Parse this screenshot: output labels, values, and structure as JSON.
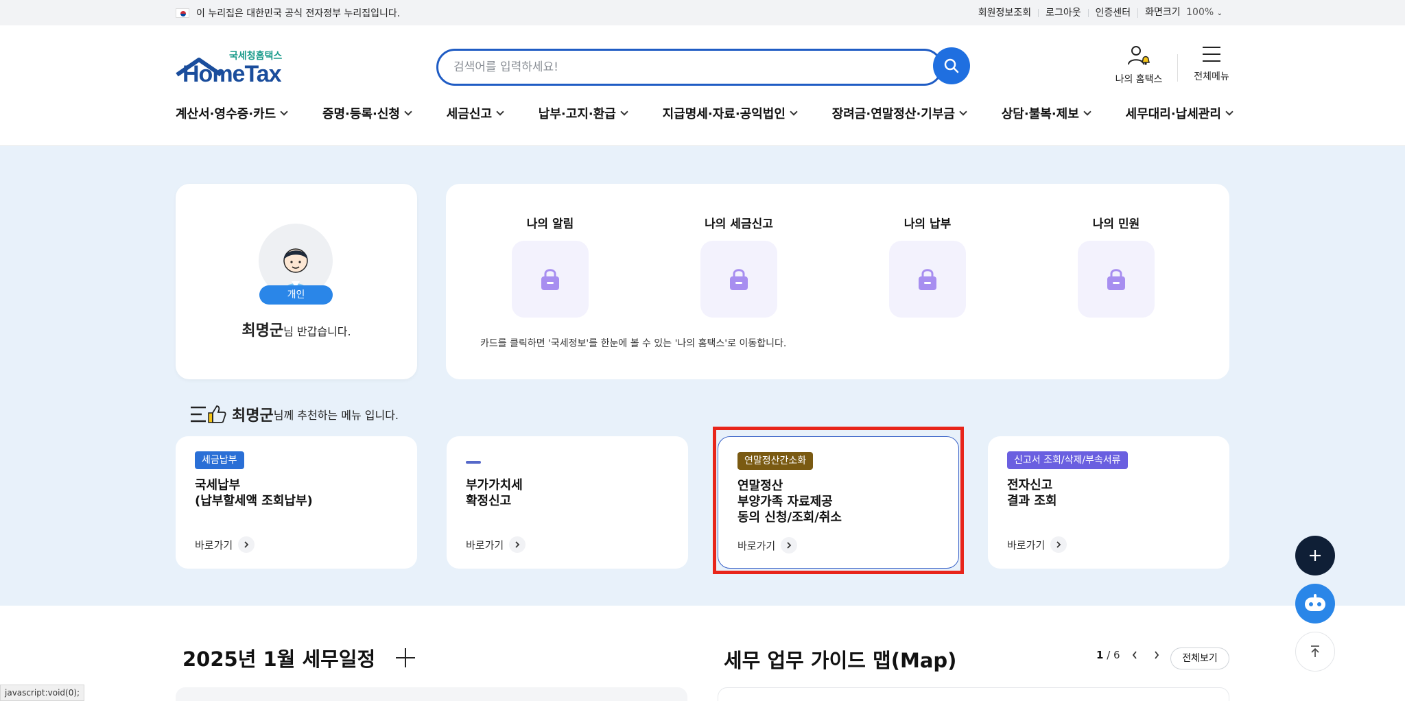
{
  "gov_bar": {
    "notice": "이 누리집은 대한민국 공식 전자정부 누리집입니다.",
    "links": [
      "회원정보조회",
      "로그아웃",
      "인증센터",
      "화면크기"
    ],
    "zoom": "100%"
  },
  "header": {
    "logo_sub": "국세청홈택스",
    "logo_main": "HomeTax",
    "search_placeholder": "검색어를 입력하세요!",
    "my_hometax": "나의 홈택스",
    "all_menu": "전체메뉴"
  },
  "gnb": [
    "계산서·영수증·카드",
    "증명·등록·신청",
    "세금신고",
    "납부·고지·환급",
    "지급명세·자료·공익법인",
    "장려금·연말정산·기부금",
    "상담·불복·제보",
    "세무대리·납세관리"
  ],
  "profile": {
    "badge": "개인",
    "name": "최명군",
    "greeting_suffix": "님 반갑습니다."
  },
  "my_cards": {
    "tiles": [
      "나의 알림",
      "나의 세금신고",
      "나의 납부",
      "나의 민원"
    ],
    "note": "카드를 클릭하면 '국세정보'를 한눈에 볼 수 있는 '나의 홈택스'로 이동합니다."
  },
  "recommend": {
    "name": "최명군",
    "suffix": "님께 추천하는 메뉴 입니다.",
    "go_label": "바로가기",
    "cards": [
      {
        "tag": "세금납부",
        "tag_color": "#2a6fd6",
        "title": "국세납부\n(납부할세액 조회납부)"
      },
      {
        "tag": "",
        "tag_color": "#5568c9",
        "title": "부가가치세\n확정신고"
      },
      {
        "tag": "연말정산간소화",
        "tag_color": "#7a5a12",
        "title": "연말정산\n부양가족 자료제공\n동의 신청/조회/취소"
      },
      {
        "tag": "신고서 조회/삭제/부속서류",
        "tag_color": "#6a5fe0",
        "title": "전자신고\n결과 조회"
      }
    ]
  },
  "schedule": {
    "title": "2025년 1월 세무일정"
  },
  "guide": {
    "title": "세무 업무 가이드 맵(Map)",
    "page_current": "1",
    "page_total": "/ 6",
    "view_all": "전체보기"
  },
  "status_bar": "javascript:void(0);",
  "colors": {
    "primary": "#1f5cc4",
    "section_bg": "#e8f1fa",
    "highlight": "#e8251a"
  }
}
